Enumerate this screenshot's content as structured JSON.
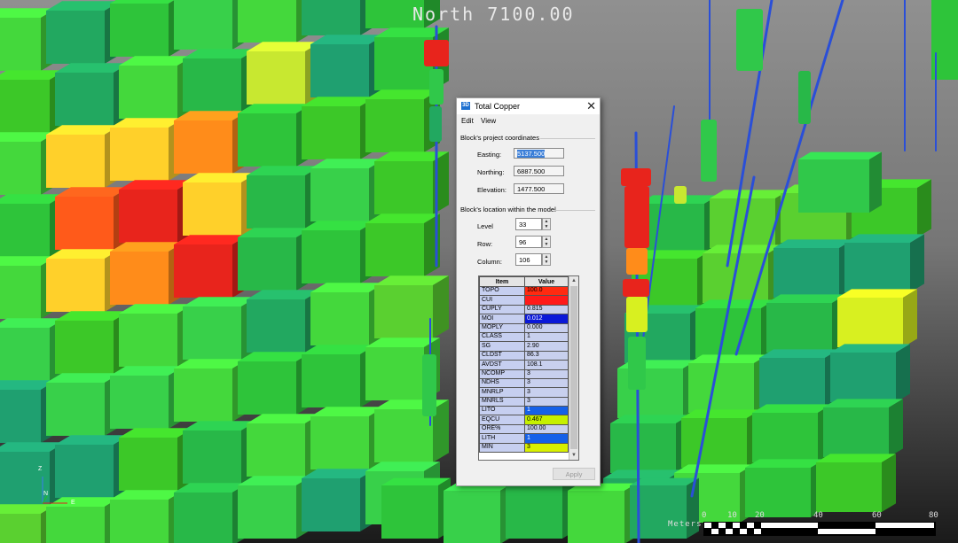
{
  "viewport": {
    "section_label": "North 7100.00",
    "colors": {
      "background_top": "#8f8f8f",
      "background_bottom": "#1c1c1c",
      "high_grade": "#e8241c",
      "mid_grade": "#ff8c1a",
      "low_grade": "#33cc33",
      "drillhole": "#2a4fd8"
    }
  },
  "axes": {
    "z": "Z",
    "n": "N",
    "e": "E"
  },
  "scale_bar": {
    "label": "Meters",
    "ticks": [
      "0",
      "10",
      "20",
      "40",
      "60",
      "80"
    ]
  },
  "dialog": {
    "icon": "3D",
    "title": "Total Copper",
    "close": "✕",
    "menu": [
      "Edit",
      "View"
    ],
    "coords_group": "Block's project coordinates",
    "easting_label": "Easting:",
    "easting_value": "5137.500",
    "northing_label": "Northing:",
    "northing_value": "6887.500",
    "elevation_label": "Elevation:",
    "elevation_value": "1477.500",
    "location_group": "Block's location within the model",
    "level_label": "Level",
    "level_value": "33",
    "row_label": "Row:",
    "row_value": "96",
    "column_label": "Column:",
    "column_value": "106",
    "table_headers": [
      "Item",
      "Value"
    ],
    "table_rows": [
      {
        "item": "TOPO",
        "value": "100.0",
        "color": "#ff2a10",
        "text": "#000000"
      },
      {
        "item": "CUI",
        "value": "0.600",
        "color": "#ff1a1a",
        "text": "#ff1a1a"
      },
      {
        "item": "CUPLY",
        "value": "0.815",
        "color": "#c8d0ee",
        "text": "#000000"
      },
      {
        "item": "MOI",
        "value": "0.012",
        "color": "#0a18d8",
        "text": "#ffffff"
      },
      {
        "item": "MOPLY",
        "value": "0.000",
        "color": "#c8d0ee",
        "text": "#000000"
      },
      {
        "item": "CLASS",
        "value": "1",
        "color": "#c8d0ee",
        "text": "#000000"
      },
      {
        "item": "SG",
        "value": "2.90",
        "color": "#c8d0ee",
        "text": "#000000"
      },
      {
        "item": "CLDST",
        "value": "86.3",
        "color": "#c8d0ee",
        "text": "#000000"
      },
      {
        "item": "AVDST",
        "value": "108.1",
        "color": "#c8d0ee",
        "text": "#000000"
      },
      {
        "item": "NCOMP",
        "value": "3",
        "color": "#c8d0ee",
        "text": "#000000"
      },
      {
        "item": "NDHS",
        "value": "3",
        "color": "#c8d0ee",
        "text": "#000000"
      },
      {
        "item": "MNRLP",
        "value": "3",
        "color": "#c8d0ee",
        "text": "#000000"
      },
      {
        "item": "MNRLS",
        "value": "3",
        "color": "#c8d0ee",
        "text": "#000000"
      },
      {
        "item": "LITO",
        "value": "1",
        "color": "#1560e8",
        "text": "#ffffff"
      },
      {
        "item": "EQCU",
        "value": "0.467",
        "color": "#c6f000",
        "text": "#000000"
      },
      {
        "item": "ORE%",
        "value": "100.00",
        "color": "#c8d0ee",
        "text": "#000000"
      },
      {
        "item": "LITH",
        "value": "1",
        "color": "#1560e8",
        "text": "#ffffff"
      },
      {
        "item": "MIN",
        "value": "3",
        "color": "#d8f000",
        "text": "#000000"
      }
    ],
    "apply_label": "Apply"
  }
}
